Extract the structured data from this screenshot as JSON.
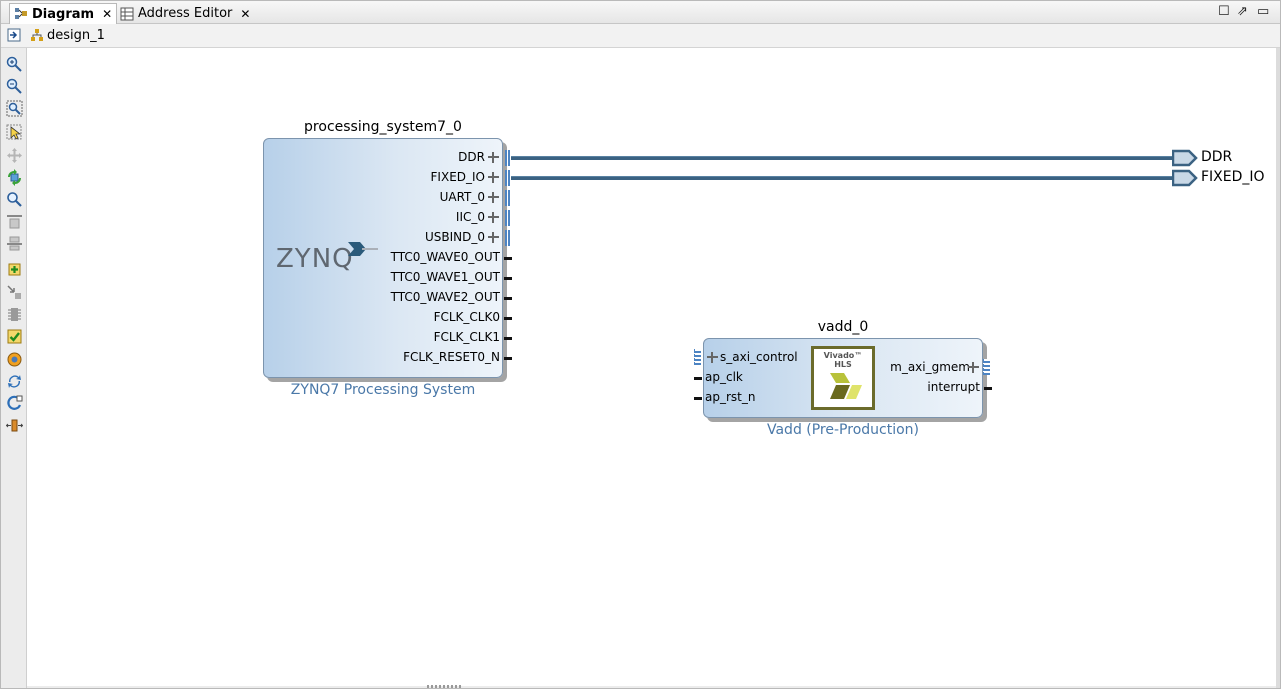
{
  "tabs": [
    {
      "label": "Diagram",
      "active": true
    },
    {
      "label": "Address Editor",
      "active": false
    }
  ],
  "breadcrumb": {
    "design": "design_1"
  },
  "toolbar_icons": [
    "fit-view-icon",
    "zoom-in-icon",
    "zoom-out-icon",
    "zoom-fit-icon",
    "select-icon",
    "pan-icon",
    "regenerate-layout-icon",
    "search-icon",
    "align-top-icon",
    "align-bottom-icon",
    "add-ip-icon",
    "make-connection-icon",
    "make-external-icon",
    "validate-design-icon",
    "run-automation-icon",
    "refresh-icon",
    "show-interface-icon",
    "expand-collapse-icon"
  ],
  "processing_system": {
    "instance": "processing_system7_0",
    "caption": "ZYNQ7 Processing System",
    "logo": "ZYNQ",
    "ports": [
      "DDR",
      "FIXED_IO",
      "UART_0",
      "IIC_0",
      "USBIND_0",
      "TTC0_WAVE0_OUT",
      "TTC0_WAVE1_OUT",
      "TTC0_WAVE2_OUT",
      "FCLK_CLK0",
      "FCLK_CLK1",
      "FCLK_RESET0_N"
    ]
  },
  "vadd": {
    "instance": "vadd_0",
    "caption": "Vadd (Pre-Production)",
    "badge": "Vivado™ HLS",
    "in_ports": [
      "s_axi_control",
      "ap_clk",
      "ap_rst_n"
    ],
    "out_ports": [
      "m_axi_gmem",
      "interrupt"
    ]
  },
  "external_ports": [
    "DDR",
    "FIXED_IO"
  ],
  "colors": {
    "wire": "#3b6282",
    "block_fill": "#b7d0e9",
    "caption": "#4a78a8"
  }
}
